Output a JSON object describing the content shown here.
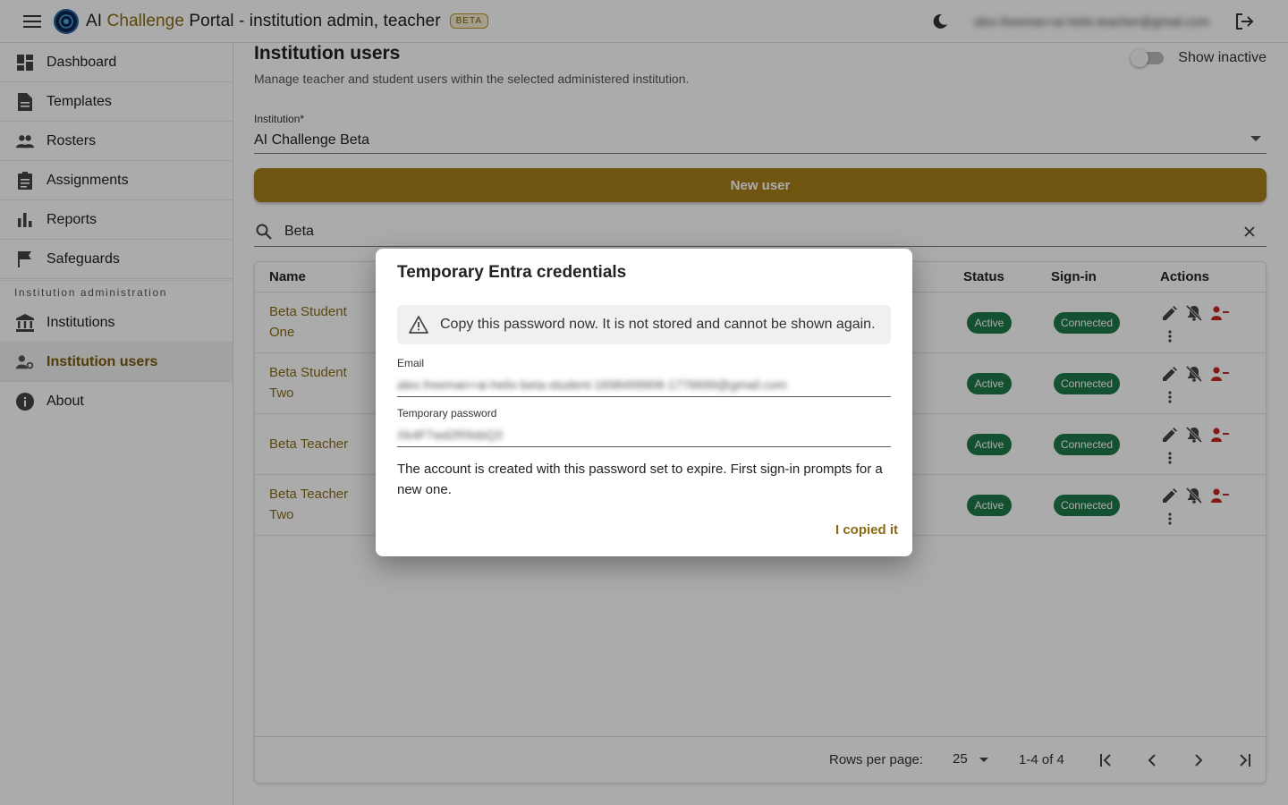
{
  "app": {
    "title_prefix": "AI ",
    "title_accent": "Challenge",
    "title_suffix": " Portal - institution admin, teacher",
    "badge": "BETA",
    "user_email": "alex.freeman+ai-helix-teacher@gmail.com"
  },
  "sidebar": {
    "items": [
      {
        "label": "Dashboard",
        "icon": "dashboard-icon"
      },
      {
        "label": "Templates",
        "icon": "document-icon"
      },
      {
        "label": "Rosters",
        "icon": "people-icon"
      },
      {
        "label": "Assignments",
        "icon": "clipboard-icon"
      },
      {
        "label": "Reports",
        "icon": "bar-chart-icon"
      },
      {
        "label": "Safeguards",
        "icon": "flag-icon"
      }
    ],
    "section_label": "Institution administration",
    "admin_items": [
      {
        "label": "Institutions",
        "icon": "bank-icon"
      },
      {
        "label": "Institution users",
        "icon": "manage-accounts-icon"
      }
    ],
    "about_label": "About"
  },
  "page": {
    "title": "Institution users",
    "subtitle": "Manage teacher and student users within the selected administered institution.",
    "show_inactive_label": "Show inactive",
    "institution_label": "Institution*",
    "institution_value": "AI Challenge Beta",
    "new_user_label": "New user",
    "search_value": "Beta"
  },
  "table": {
    "headers": {
      "name": "Name",
      "status": "Status",
      "signin": "Sign-in",
      "actions": "Actions"
    },
    "rows": [
      {
        "name": "Beta Student One",
        "status": "Active",
        "signin": "Connected"
      },
      {
        "name": "Beta Student Two",
        "status": "Active",
        "signin": "Connected"
      },
      {
        "name": "Beta Teacher",
        "status": "Active",
        "signin": "Connected"
      },
      {
        "name": "Beta Teacher Two",
        "status": "Active",
        "signin": "Connected"
      }
    ],
    "footer": {
      "rows_per_page_label": "Rows per page:",
      "rows_per_page_value": "25",
      "range": "1-4 of 4"
    }
  },
  "dialog": {
    "title": "Temporary Entra credentials",
    "warning": "Copy this password now. It is not stored and cannot be shown again.",
    "email_label": "Email",
    "email_value": "alex.freeman+ai-helix-beta-student-1698499906-1776699@gmail.com",
    "password_label": "Temporary password",
    "password_value": "Xk4F7wd2R9sbQ3",
    "note": "The account is created with this password set to expire. First sign-in prompts for a new one.",
    "confirm_label": "I copied it"
  },
  "colors": {
    "accent": "#8a6a12",
    "primary_button": "#a87f1a",
    "chip_green": "#1e7a4a",
    "danger": "#c62828"
  }
}
